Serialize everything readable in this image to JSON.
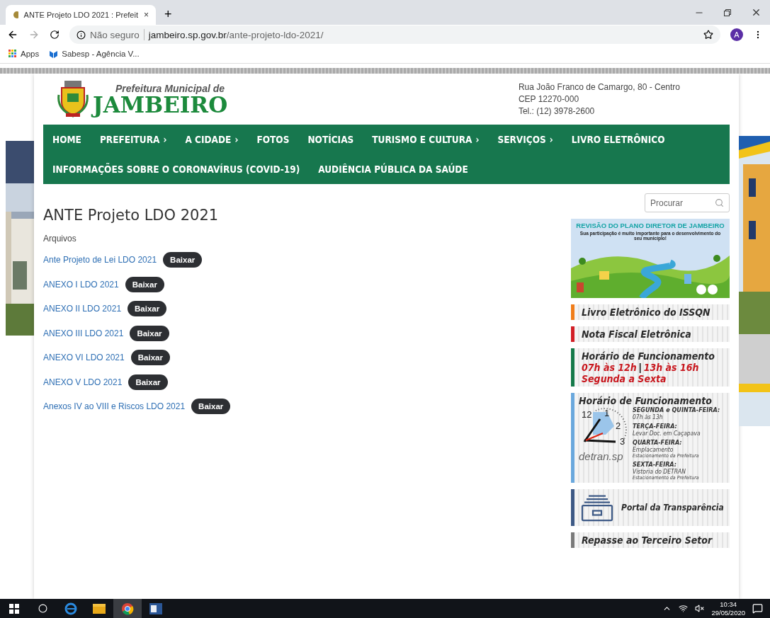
{
  "browser": {
    "tab": {
      "title": "ANTE Projeto LDO 2021 : Prefeit",
      "close": "×"
    },
    "new_tab": "+",
    "address": {
      "security": "Não seguro",
      "url_host": "jambeiro.sp.gov.br",
      "url_path": "/ante-projeto-ldo-2021/"
    },
    "profile": "A",
    "bookmarks": [
      {
        "kind": "apps",
        "label": "Apps"
      },
      {
        "kind": "site",
        "label": "Sabesp - Agência V..."
      }
    ]
  },
  "header": {
    "org_line": "Prefeitura Municipal de",
    "org_name": "JAMBEIRO",
    "address_lines": [
      "Rua João Franco de Camargo, 80 - Centro",
      "CEP 12270-000",
      "Tel.: (12) 3978-2600"
    ]
  },
  "nav": {
    "items": [
      {
        "label": "HOME",
        "submenu": false
      },
      {
        "label": "PREFEITURA",
        "submenu": true
      },
      {
        "label": "A CIDADE",
        "submenu": true
      },
      {
        "label": "FOTOS",
        "submenu": false
      },
      {
        "label": "NOTÍCIAS",
        "submenu": false
      },
      {
        "label": "TURISMO E CULTURA",
        "submenu": true
      },
      {
        "label": "SERVIÇOS",
        "submenu": true
      },
      {
        "label": "LIVRO ELETRÔNICO",
        "submenu": false
      },
      {
        "label": "INFORMAÇÕES SOBRE O CORONAVÍRUS (COVID-19)",
        "submenu": false
      },
      {
        "label": "AUDIÊNCIA PÚBLICA DA SAÚDE",
        "submenu": false
      }
    ],
    "submenu_mark": "›"
  },
  "content": {
    "title": "ANTE Projeto LDO 2021",
    "section_label": "Arquivos",
    "files": [
      {
        "name": "Ante Projeto de Lei LDO 2021",
        "button": "Baixar"
      },
      {
        "name": "ANEXO I LDO 2021",
        "button": "Baixar"
      },
      {
        "name": "ANEXO II LDO 2021",
        "button": "Baixar"
      },
      {
        "name": "ANEXO III LDO 2021",
        "button": "Baixar"
      },
      {
        "name": "ANEXO VI LDO 2021",
        "button": "Baixar"
      },
      {
        "name": "ANEXO V LDO 2021",
        "button": "Baixar"
      },
      {
        "name": "Anexos IV ao VIII e Riscos LDO 2021",
        "button": "Baixar"
      }
    ]
  },
  "sidebar": {
    "search": {
      "placeholder": "Procurar"
    },
    "plan_banner": {
      "title": "REVISÃO DO PLANO DIRETOR DE JAMBEIRO",
      "subtitle": "Sua participação é muito importante para o desenvolvimento do seu município!"
    },
    "banners": [
      {
        "kind": "link",
        "color": "#f07d1a",
        "title": "Livro Eletrônico do ISSQN"
      },
      {
        "kind": "link",
        "color": "#d21f26",
        "title": "Nota Fiscal Eletrônica"
      },
      {
        "kind": "hours",
        "color": "#157a4a",
        "title": "Horário de Funcionamento",
        "first": "07h às 12h",
        "separator": "|",
        "second": "13h às 16h",
        "days": "Segunda a Sexta"
      },
      {
        "kind": "detran",
        "color": "#6aa8dd",
        "title": "Horário de Funcionamento",
        "clock_numbers": [
          "12",
          "1",
          "2",
          "3"
        ],
        "logo": "detran.sp",
        "schedule": [
          {
            "day": "SEGUNDA e QUINTA-FEIRA:",
            "lines": [
              "07h às 13h"
            ]
          },
          {
            "day": "TERÇA-FEIRA:",
            "lines": [
              "Levar Doc. em Caçapava"
            ]
          },
          {
            "day": "QUARTA-FEIRA:",
            "lines": [
              "Emplacamento",
              "Estacionamento da Prefeitura"
            ]
          },
          {
            "day": "SEXTA-FEIRA:",
            "lines": [
              "Vistoria do DETRAN",
              "Estacionamento da Prefeitura"
            ]
          }
        ]
      },
      {
        "kind": "portal",
        "color": "#3e5a86",
        "title": "Portal da Transparência"
      },
      {
        "kind": "link",
        "color": "#7a7a7a",
        "title": "Repasse ao Terceiro Setor"
      }
    ]
  },
  "taskbar": {
    "time": "10:34",
    "date": "29/05/2020"
  }
}
